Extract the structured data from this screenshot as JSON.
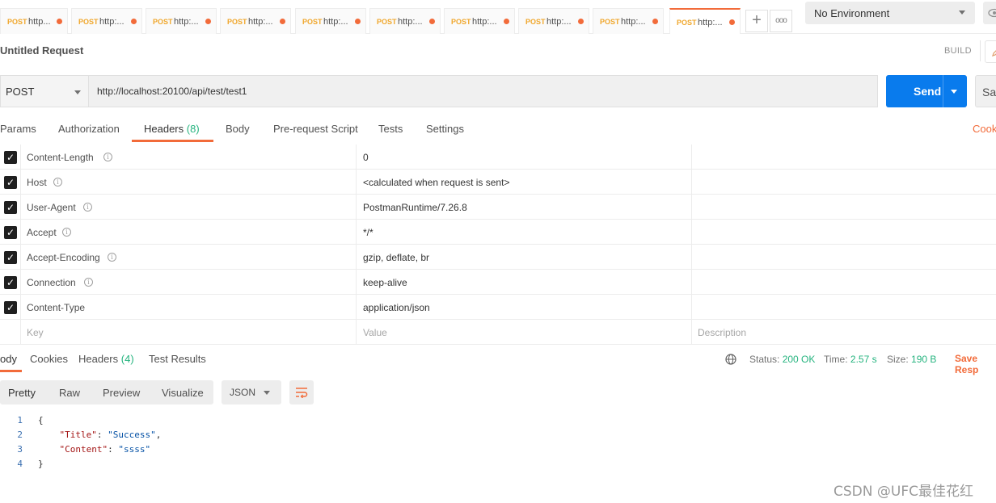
{
  "tabs": [
    {
      "method": "POST",
      "url": "http...",
      "modified": true
    },
    {
      "method": "POST",
      "url": "http:...",
      "modified": true
    },
    {
      "method": "POST",
      "url": "http:...",
      "modified": true
    },
    {
      "method": "POST",
      "url": "http:...",
      "modified": true
    },
    {
      "method": "POST",
      "url": "http:...",
      "modified": true
    },
    {
      "method": "POST",
      "url": "http:...",
      "modified": true
    },
    {
      "method": "POST",
      "url": "http:...",
      "modified": true
    },
    {
      "method": "POST",
      "url": "http:...",
      "modified": true
    },
    {
      "method": "POST",
      "url": "http:...",
      "modified": true
    },
    {
      "method": "POST",
      "url": "http:...",
      "modified": true,
      "active": true
    }
  ],
  "toolbar": {
    "new_tab": "+",
    "more_tabs": "ooo",
    "environment": "No Environment"
  },
  "request": {
    "title": "Untitled Request",
    "build_label": "BUILD",
    "method": "POST",
    "url": "http://localhost:20100/api/test/test1",
    "send_label": "Send",
    "save_label": "Sa"
  },
  "request_tabs": {
    "params": "Params",
    "authorization": "Authorization",
    "headers": "Headers",
    "headers_count": "(8)",
    "body": "Body",
    "pre_request": "Pre-request Script",
    "tests": "Tests",
    "settings": "Settings",
    "cookies": "Cook"
  },
  "headers": [
    {
      "key": "Content-Length",
      "value": "0",
      "checked": true
    },
    {
      "key": "Host",
      "value": "<calculated when request is sent>",
      "checked": true
    },
    {
      "key": "User-Agent",
      "value": "PostmanRuntime/7.26.8",
      "checked": true
    },
    {
      "key": "Accept",
      "value": "*/*",
      "checked": true
    },
    {
      "key": "Accept-Encoding",
      "value": "gzip, deflate, br",
      "checked": true
    },
    {
      "key": "Connection",
      "value": "keep-alive",
      "checked": true
    },
    {
      "key": "Content-Type",
      "value": "application/json",
      "checked": true
    }
  ],
  "headers_placeholder": {
    "key": "Key",
    "value": "Value",
    "description": "Description"
  },
  "response_tabs": {
    "body": "ody",
    "cookies": "Cookies",
    "headers": "Headers",
    "headers_count": "(4)",
    "test_results": "Test Results"
  },
  "response_status": {
    "status_label": "Status:",
    "status_value": "200 OK",
    "time_label": "Time:",
    "time_value": "2.57 s",
    "size_label": "Size:",
    "size_value": "190 B",
    "save_response": "Save Resp"
  },
  "format": {
    "pretty": "Pretty",
    "raw": "Raw",
    "preview": "Preview",
    "visualize": "Visualize",
    "language": "JSON"
  },
  "code_lines": [
    {
      "n": "1",
      "text": "{"
    },
    {
      "n": "2",
      "key": "\"Title\"",
      "sep": ": ",
      "val": "\"Success\"",
      "end": ","
    },
    {
      "n": "3",
      "key": "\"Content\"",
      "sep": ": ",
      "val": "\"ssss\"",
      "end": ""
    },
    {
      "n": "4",
      "text": "}"
    }
  ],
  "watermark": "CSDN @UFC最佳花红",
  "colors": {
    "accent": "#f26b3a",
    "send": "#097bed",
    "success": "#26b47f",
    "method_post": "#f0a72c"
  }
}
